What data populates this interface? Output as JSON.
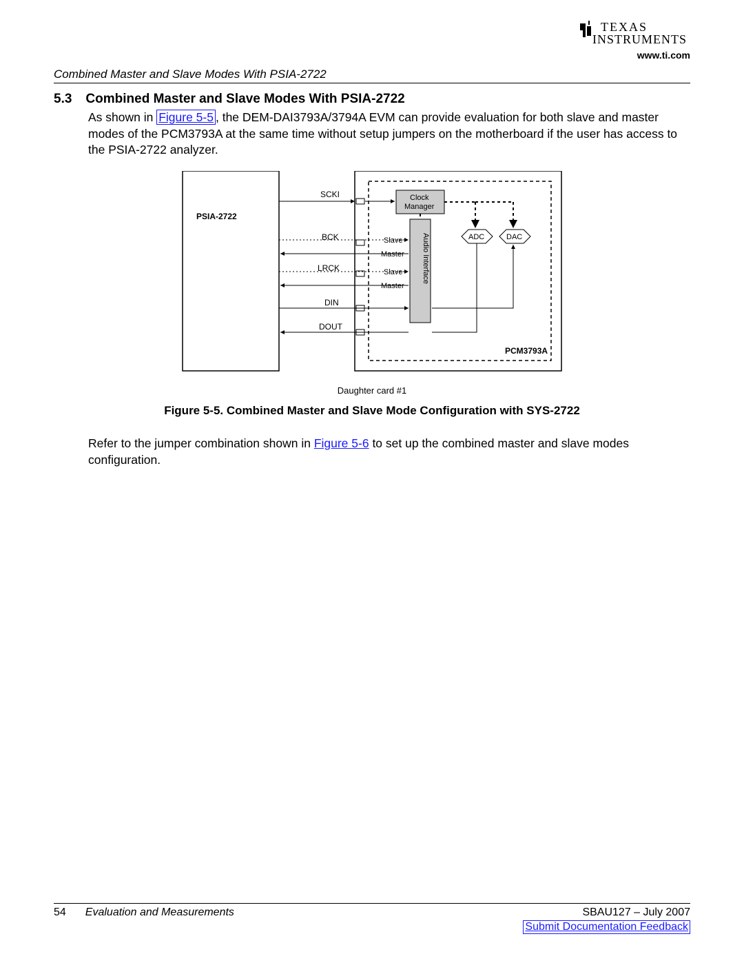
{
  "header": {
    "logo_text_top": "TEXAS",
    "logo_text_bottom": "INSTRUMENTS",
    "url": "www.ti.com"
  },
  "running_head": "Combined Master and Slave Modes With PSIA-2722",
  "section": {
    "number": "5.3",
    "title": "Combined Master and Slave Modes With PSIA-2722",
    "body_pre": "As shown in ",
    "fig_link": "Figure 5-5",
    "body_post": ", the DEM-DAI3793A/3794A EVM can provide evaluation for both slave and master modes of the PCM3793A at the same time without setup jumpers on the motherboard if the user has access to the PSIA-2722 analyzer."
  },
  "diagram": {
    "psia_label": "PSIA-2722",
    "signals": {
      "scki": "SCKI",
      "bck": "BCK",
      "lrck": "LRCK",
      "din": "DIN",
      "dout": "DOUT"
    },
    "clock_top": "Clock",
    "clock_bot": "Manager",
    "slave": "Slave",
    "master": "Master",
    "audio": "Audio Interface",
    "adc": "ADC",
    "dac": "DAC",
    "chip": "PCM3793A",
    "daughter": "Daughter card #1"
  },
  "figure_caption": "Figure 5-5. Combined Master and Slave Mode Configuration with SYS-2722",
  "para2": {
    "pre": "Refer to the jumper combination shown in ",
    "link": "Figure 5-6",
    "post": " to set up the combined master and slave modes configuration."
  },
  "footer": {
    "page": "54",
    "section": "Evaluation and Measurements",
    "doc": "SBAU127 – July 2007",
    "feedback": "Submit Documentation Feedback"
  }
}
